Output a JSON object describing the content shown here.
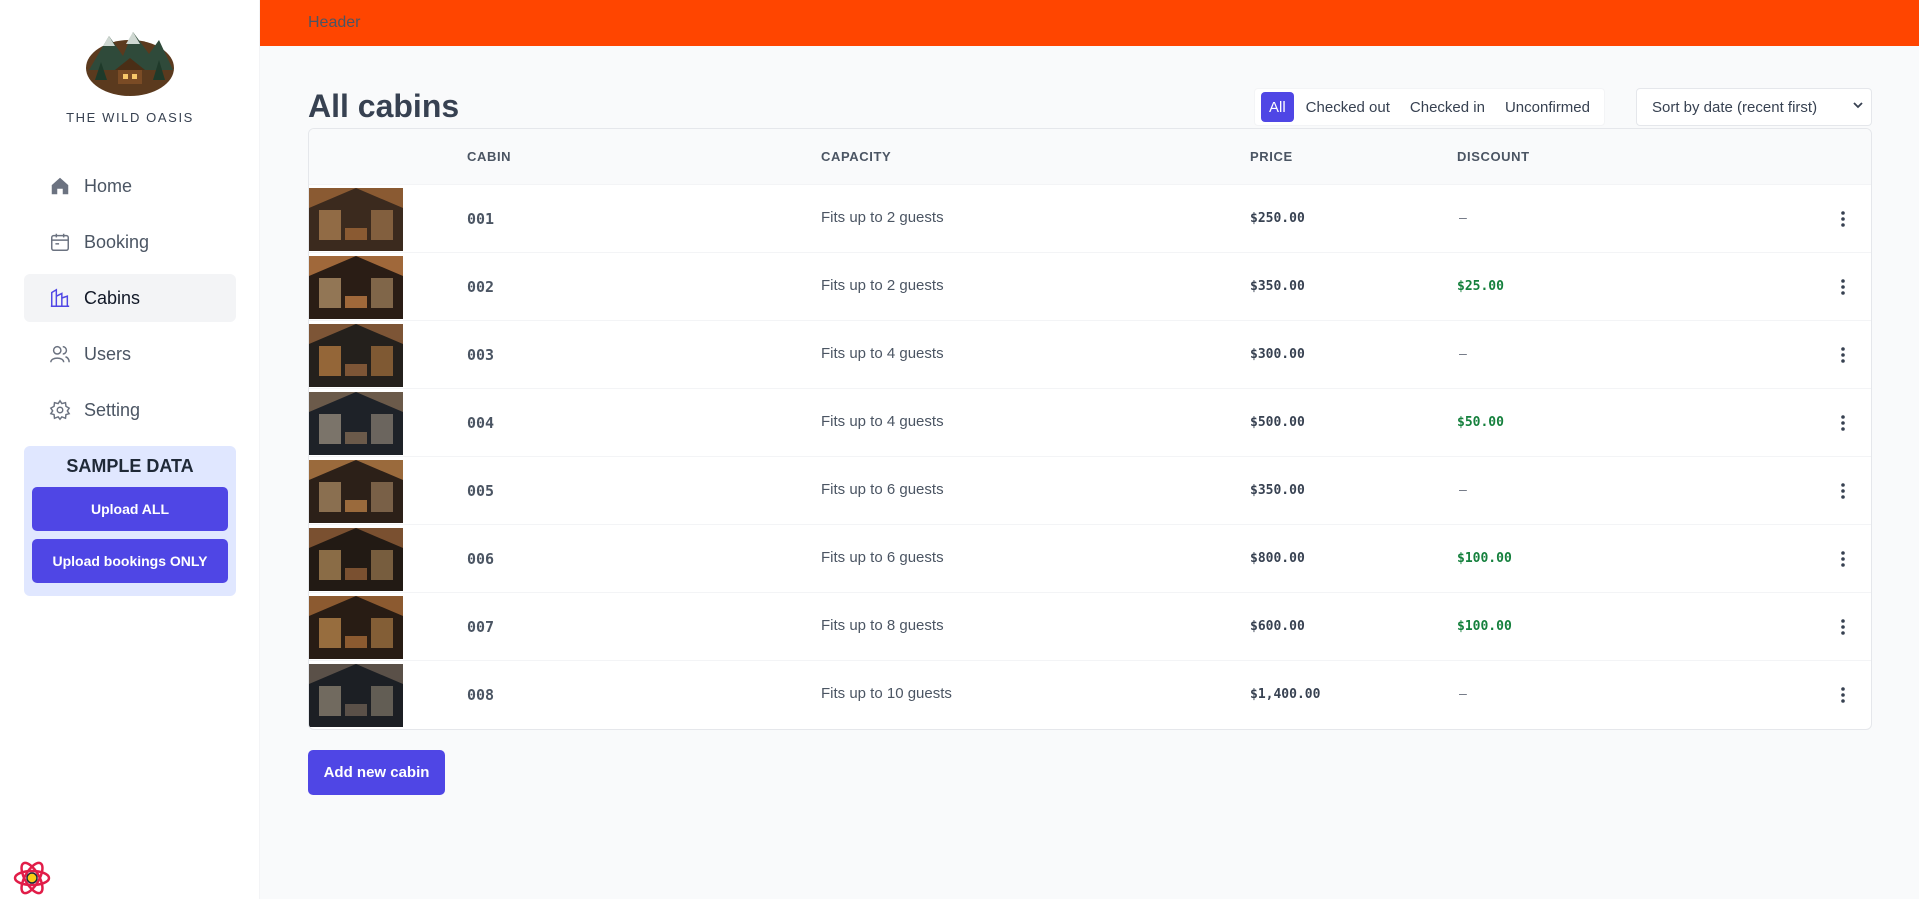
{
  "brand": {
    "logo_icon": "mountain-cabin-logo",
    "name": "THE WILD OASIS"
  },
  "header": {
    "label": "Header"
  },
  "nav": [
    {
      "label": "Home",
      "icon": "home-icon"
    },
    {
      "label": "Booking",
      "icon": "calendar-icon"
    },
    {
      "label": "Cabins",
      "icon": "cabin-icon"
    },
    {
      "label": "Users",
      "icon": "users-icon"
    },
    {
      "label": "Setting",
      "icon": "gear-icon"
    }
  ],
  "sample": {
    "title": "SAMPLE DATA",
    "upload_all": "Upload ALL",
    "upload_bookings": "Upload bookings ONLY"
  },
  "page": {
    "title": "All cabins"
  },
  "filters": {
    "all": "All",
    "checked_out": "Checked out",
    "checked_in": "Checked in",
    "unconfirmed": "Unconfirmed",
    "active": "All"
  },
  "sort": {
    "selected": "Sort by date (recent first)"
  },
  "table": {
    "headers": {
      "cabin": "CABIN",
      "capacity": "CAPACITY",
      "price": "PRICE",
      "discount": "DISCOUNT"
    },
    "rows": [
      {
        "cabin": "001",
        "capacity": "Fits up to 2 guests",
        "price": "$250.00",
        "discount": "—"
      },
      {
        "cabin": "002",
        "capacity": "Fits up to 2 guests",
        "price": "$350.00",
        "discount": "$25.00"
      },
      {
        "cabin": "003",
        "capacity": "Fits up to 4 guests",
        "price": "$300.00",
        "discount": "—"
      },
      {
        "cabin": "004",
        "capacity": "Fits up to 4 guests",
        "price": "$500.00",
        "discount": "$50.00"
      },
      {
        "cabin": "005",
        "capacity": "Fits up to 6 guests",
        "price": "$350.00",
        "discount": "—"
      },
      {
        "cabin": "006",
        "capacity": "Fits up to 6 guests",
        "price": "$800.00",
        "discount": "$100.00"
      },
      {
        "cabin": "007",
        "capacity": "Fits up to 8 guests",
        "price": "$600.00",
        "discount": "$100.00"
      },
      {
        "cabin": "008",
        "capacity": "Fits up to 10 guests",
        "price": "$1,400.00",
        "discount": "—"
      }
    ]
  },
  "actions": {
    "add_cabin": "Add new cabin"
  },
  "colors": {
    "header": "#ff4500",
    "accent": "#4f46e5",
    "discount": "#15803d"
  },
  "dev_icon": "react-devtools-icon"
}
